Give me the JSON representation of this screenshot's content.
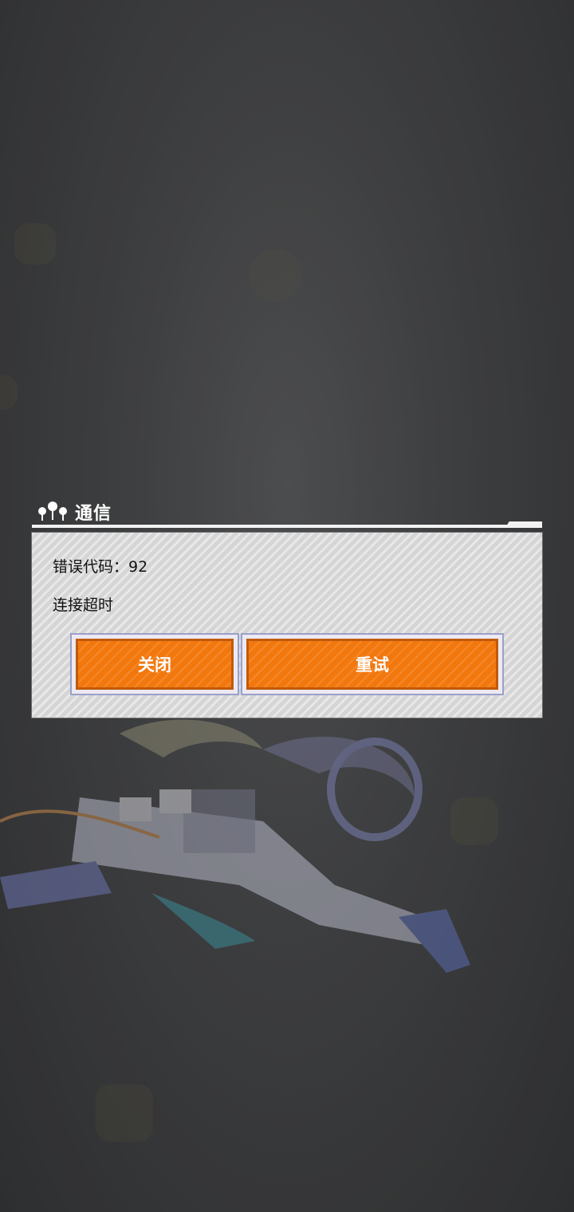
{
  "dialog": {
    "icon": "network-nodes-icon",
    "title": "通信",
    "error_code": "错误代码：92",
    "message": "连接超时",
    "buttons": {
      "close_label": "关闭",
      "retry_label": "重试"
    }
  },
  "colors": {
    "accent_orange": "#f2780e",
    "panel_gray": "#dcdcdc",
    "background": "#4a4b4d"
  }
}
